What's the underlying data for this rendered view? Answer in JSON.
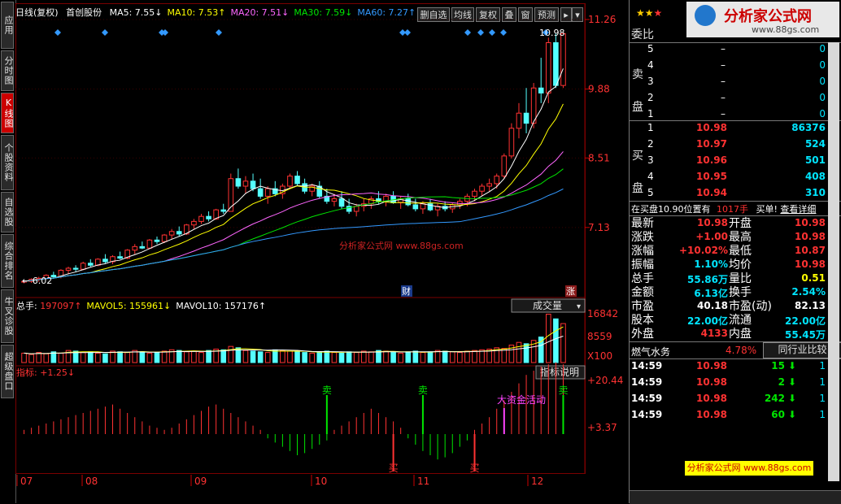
{
  "left_tabs": [
    {
      "label": "应用",
      "active": false
    },
    {
      "label": "分时图",
      "active": false
    },
    {
      "label": "K线图",
      "active": true
    },
    {
      "label": "个股资料",
      "active": false
    },
    {
      "label": "自选股",
      "active": false
    },
    {
      "label": "综合排名",
      "active": false
    },
    {
      "label": "牛叉诊股",
      "active": false
    },
    {
      "label": "超级盘口",
      "active": false
    }
  ],
  "kchart": {
    "title": "日线(复权)",
    "stock_name": "首创股份",
    "ma_labels": [
      {
        "text": "MA5: 7.55↓",
        "color": "#ffffff"
      },
      {
        "text": "MA10: 7.53↑",
        "color": "#ffff00"
      },
      {
        "text": "MA20: 7.51↓",
        "color": "#ff66ff"
      },
      {
        "text": "MA30: 7.59↓",
        "color": "#00e600"
      },
      {
        "text": "MA60: 7.27↑",
        "color": "#3399ff"
      }
    ],
    "buttons": [
      "删自选",
      "均线",
      "复权",
      "叠",
      "窗",
      "预测"
    ],
    "price_axis": [
      "11.26",
      "9.88",
      "8.51",
      "7.13"
    ],
    "high_label": "10.98",
    "low_label": "6.02",
    "watermark": "分析家公式网 www.88gs.com",
    "events": [
      "财",
      "涨"
    ],
    "candles": [
      [
        6.05,
        6.08,
        6.02,
        6.06
      ],
      [
        6.06,
        6.12,
        6.03,
        6.1
      ],
      [
        6.1,
        6.15,
        6.05,
        6.12
      ],
      [
        6.12,
        6.2,
        6.1,
        6.18
      ],
      [
        6.18,
        6.25,
        6.12,
        6.15
      ],
      [
        6.15,
        6.3,
        6.12,
        6.28
      ],
      [
        6.28,
        6.35,
        6.2,
        6.32
      ],
      [
        6.32,
        6.38,
        6.25,
        6.3
      ],
      [
        6.3,
        6.45,
        6.28,
        6.42
      ],
      [
        6.42,
        6.5,
        6.35,
        6.38
      ],
      [
        6.38,
        6.52,
        6.36,
        6.5
      ],
      [
        6.5,
        6.6,
        6.42,
        6.45
      ],
      [
        6.45,
        6.58,
        6.4,
        6.55
      ],
      [
        6.55,
        6.65,
        6.5,
        6.52
      ],
      [
        6.52,
        6.7,
        6.5,
        6.68
      ],
      [
        6.68,
        6.8,
        6.6,
        6.75
      ],
      [
        6.75,
        6.85,
        6.7,
        6.72
      ],
      [
        6.72,
        6.9,
        6.7,
        6.88
      ],
      [
        6.88,
        6.95,
        6.8,
        6.85
      ],
      [
        6.85,
        7.0,
        6.82,
        6.98
      ],
      [
        6.98,
        7.1,
        6.9,
        7.05
      ],
      [
        7.05,
        7.15,
        6.95,
        7.0
      ],
      [
        7.0,
        7.2,
        6.98,
        7.18
      ],
      [
        7.18,
        7.3,
        7.1,
        7.25
      ],
      [
        7.25,
        7.4,
        7.2,
        7.35
      ],
      [
        7.35,
        7.45,
        7.25,
        7.3
      ],
      [
        7.3,
        7.5,
        7.28,
        7.48
      ],
      [
        7.48,
        7.6,
        7.4,
        7.45
      ],
      [
        7.45,
        8.2,
        7.45,
        8.1
      ],
      [
        8.1,
        8.3,
        7.9,
        7.95
      ],
      [
        7.95,
        8.15,
        7.8,
        8.05
      ],
      [
        8.05,
        8.2,
        7.85,
        7.9
      ],
      [
        7.9,
        8.1,
        7.7,
        7.75
      ],
      [
        7.75,
        7.95,
        7.6,
        7.9
      ],
      [
        7.9,
        8.05,
        7.75,
        7.8
      ],
      [
        7.8,
        8.0,
        7.7,
        7.95
      ],
      [
        7.95,
        8.2,
        7.9,
        8.15
      ],
      [
        8.15,
        8.25,
        7.95,
        8.0
      ],
      [
        8.0,
        8.1,
        7.8,
        7.85
      ],
      [
        7.85,
        8.0,
        7.75,
        7.95
      ],
      [
        7.95,
        8.05,
        7.7,
        7.75
      ],
      [
        7.75,
        7.9,
        7.6,
        7.65
      ],
      [
        7.65,
        7.8,
        7.55,
        7.7
      ],
      [
        7.7,
        7.85,
        7.5,
        7.55
      ],
      [
        7.55,
        7.7,
        7.4,
        7.45
      ],
      [
        7.45,
        7.6,
        7.35,
        7.55
      ],
      [
        7.55,
        7.7,
        7.45,
        7.6
      ],
      [
        7.6,
        7.75,
        7.5,
        7.7
      ],
      [
        7.7,
        7.85,
        7.6,
        7.65
      ],
      [
        7.65,
        7.8,
        7.55,
        7.75
      ],
      [
        7.75,
        7.85,
        7.6,
        7.62
      ],
      [
        7.62,
        7.75,
        7.5,
        7.7
      ],
      [
        7.7,
        7.8,
        7.55,
        7.58
      ],
      [
        7.58,
        7.7,
        7.45,
        7.5
      ],
      [
        7.5,
        7.65,
        7.4,
        7.6
      ],
      [
        7.6,
        7.7,
        7.45,
        7.48
      ],
      [
        7.48,
        7.6,
        7.35,
        7.55
      ],
      [
        7.55,
        7.65,
        7.45,
        7.5
      ],
      [
        7.5,
        7.62,
        7.42,
        7.58
      ],
      [
        7.58,
        7.7,
        7.5,
        7.65
      ],
      [
        7.65,
        7.8,
        7.55,
        7.75
      ],
      [
        7.75,
        7.9,
        7.65,
        7.85
      ],
      [
        7.85,
        8.0,
        7.75,
        7.95
      ],
      [
        7.95,
        8.1,
        7.85,
        8.0
      ],
      [
        8.0,
        8.2,
        7.9,
        8.15
      ],
      [
        8.15,
        8.6,
        8.1,
        8.55
      ],
      [
        8.55,
        9.2,
        8.5,
        9.1
      ],
      [
        9.1,
        9.6,
        8.9,
        9.4
      ],
      [
        9.4,
        9.9,
        9.0,
        9.2
      ],
      [
        9.2,
        10.0,
        9.1,
        9.9
      ],
      [
        9.9,
        10.5,
        9.6,
        9.8
      ],
      [
        9.8,
        10.9,
        9.6,
        10.8
      ],
      [
        10.8,
        10.98,
        9.9,
        9.95
      ],
      [
        9.95,
        10.98,
        9.9,
        10.98
      ]
    ],
    "x_dates": [
      "07",
      "08",
      "09",
      "10",
      "11",
      "12"
    ]
  },
  "volume": {
    "label": "总手: 197097↑",
    "mavol5": "MAVOL5: 155961↓",
    "mavol10": "MAVOL10: 157176↑",
    "selector": "成交量",
    "axis": [
      "16842",
      "8559",
      "X100"
    ],
    "bars": [
      14,
      12,
      15,
      13,
      16,
      14,
      18,
      17,
      15,
      16,
      14,
      13,
      17,
      16,
      15,
      18,
      16,
      14,
      15,
      17,
      19,
      18,
      16,
      17,
      15,
      18,
      20,
      19,
      24,
      22,
      18,
      17,
      16,
      15,
      19,
      18,
      17,
      16,
      15,
      14,
      16,
      17,
      15,
      14,
      16,
      15,
      17,
      16,
      18,
      17,
      15,
      14,
      16,
      17,
      15,
      16,
      18,
      17,
      16,
      15,
      17,
      18,
      19,
      20,
      22,
      21,
      26,
      30,
      28,
      33,
      38,
      72,
      65,
      58
    ]
  },
  "indicator": {
    "label": "指标: +1.25↓",
    "help_button": "指标说明",
    "axis": [
      "+20.44",
      "+3.37"
    ],
    "sell_label": "卖",
    "buy_label": "买",
    "capital_label": "大资金活动",
    "values": [
      2,
      3,
      4,
      5,
      6,
      7,
      8,
      9,
      10,
      11,
      12,
      13,
      14,
      12,
      10,
      8,
      6,
      4,
      3,
      2,
      3,
      5,
      7,
      9,
      11,
      13,
      14,
      12,
      10,
      8,
      6,
      4,
      2,
      -2,
      -4,
      -6,
      -8,
      -10,
      -9,
      -7,
      -5,
      -3,
      2,
      4,
      6,
      8,
      10,
      12,
      10,
      8,
      6,
      3,
      -2,
      -5,
      -8,
      -10,
      -12,
      -11,
      -9,
      -6,
      -3,
      2,
      5,
      8,
      12,
      16,
      20,
      24,
      28,
      30,
      32,
      33,
      34,
      33
    ]
  },
  "quote": {
    "ratio_label": "委比",
    "sell_label": "卖盘",
    "buy_label": "买盘",
    "sell_levels": [
      {
        "n": "5",
        "p": "–",
        "v": "0"
      },
      {
        "n": "4",
        "p": "–",
        "v": "0"
      },
      {
        "n": "3",
        "p": "–",
        "v": "0"
      },
      {
        "n": "2",
        "p": "–",
        "v": "0"
      },
      {
        "n": "1",
        "p": "–",
        "v": "0"
      }
    ],
    "buy_levels": [
      {
        "n": "1",
        "p": "10.98",
        "v": "86376"
      },
      {
        "n": "2",
        "p": "10.97",
        "v": "524"
      },
      {
        "n": "3",
        "p": "10.96",
        "v": "501"
      },
      {
        "n": "4",
        "p": "10.95",
        "v": "408"
      },
      {
        "n": "5",
        "p": "10.94",
        "v": "310"
      }
    ],
    "note_left": "在买盘10.90位置有",
    "note_amount": "1017手",
    "note_right": "买单!",
    "detail_link": "查看详细",
    "stats": [
      {
        "l1": "最新",
        "v1": "10.98",
        "c1": "red",
        "l2": "开盘",
        "v2": "10.98",
        "c2": "red"
      },
      {
        "l1": "涨跌",
        "v1": "+1.00",
        "c1": "red",
        "l2": "最高",
        "v2": "10.98",
        "c2": "red"
      },
      {
        "l1": "涨幅",
        "v1": "+10.02%",
        "c1": "red",
        "l2": "最低",
        "v2": "10.87",
        "c2": "red"
      },
      {
        "l1": "振幅",
        "v1": "1.10%",
        "c1": "cyan",
        "l2": "均价",
        "v2": "10.98",
        "c2": "red"
      },
      {
        "l1": "总手",
        "v1": "55.86万",
        "c1": "cyan",
        "l2": "量比",
        "v2": "0.51",
        "c2": "yellow"
      },
      {
        "l1": "金额",
        "v1": "6.13亿",
        "c1": "cyan",
        "l2": "换手",
        "v2": "2.54%",
        "c2": "cyan"
      },
      {
        "l1": "市盈",
        "v1": "40.18",
        "c1": "white",
        "l2": "市盈(动)",
        "v2": "82.13",
        "c2": "white"
      },
      {
        "l1": "股本",
        "v1": "22.00亿",
        "c1": "cyan",
        "l2": "流通",
        "v2": "22.00亿",
        "c2": "cyan"
      },
      {
        "l1": "外盘",
        "v1": "4133",
        "c1": "red",
        "l2": "内盘",
        "v2": "55.45万",
        "c2": "cyan"
      }
    ],
    "industry": "燃气水务",
    "industry_pct": "4.78%",
    "compare_button": "同行业比较",
    "ticks": [
      {
        "t": "14:59",
        "p": "10.98",
        "v": "15",
        "n": "1"
      },
      {
        "t": "14:59",
        "p": "10.98",
        "v": "2",
        "n": "1"
      },
      {
        "t": "14:59",
        "p": "10.98",
        "v": "242",
        "n": "1"
      },
      {
        "t": "14:59",
        "p": "10.98",
        "v": "60",
        "n": "1"
      }
    ],
    "brand_title": "分析家公式网",
    "brand_url": "www.88gs.com",
    "banner": "分析家公式网 www.88gs.com"
  }
}
